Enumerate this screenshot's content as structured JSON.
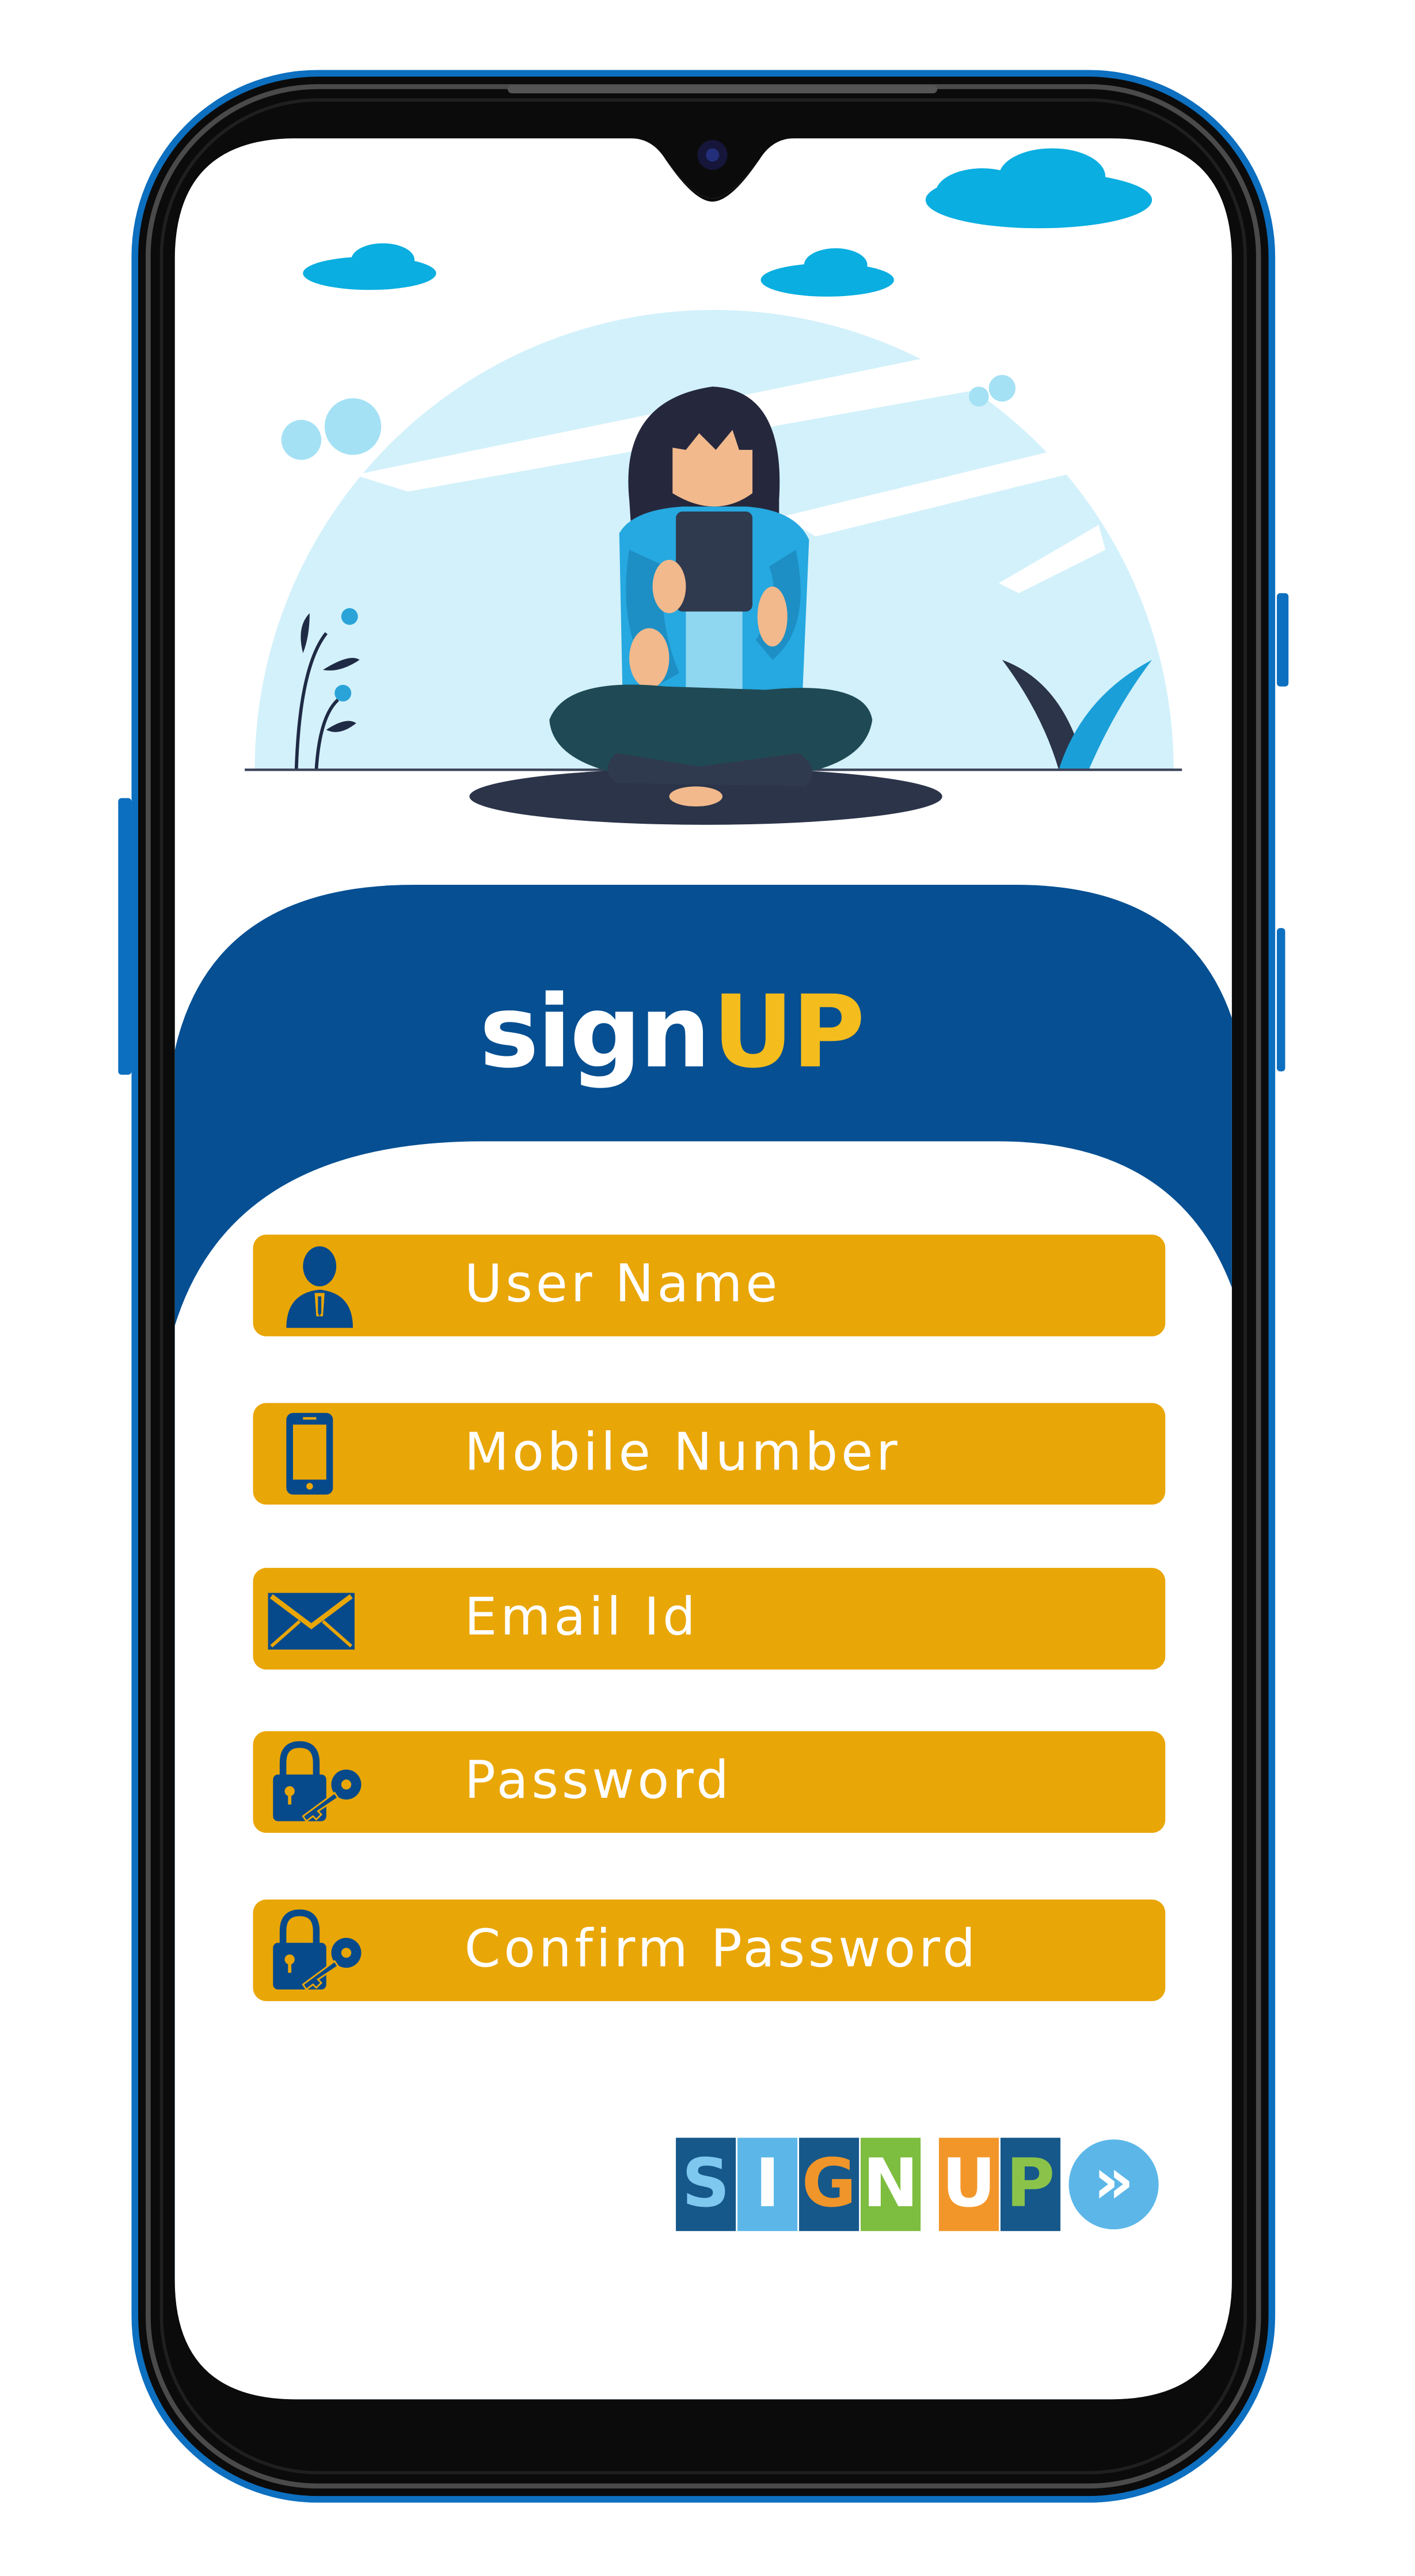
{
  "brand": {
    "sign_part": "sign",
    "up_part": "UP"
  },
  "form": {
    "fields": [
      {
        "label": "User Name",
        "icon": "user-icon"
      },
      {
        "label": "Mobile Number",
        "icon": "mobile-icon"
      },
      {
        "label": "Email Id",
        "icon": "envelope-icon"
      },
      {
        "label": "Password",
        "icon": "lock-key-icon"
      },
      {
        "label": "Confirm Password",
        "icon": "lock-key-icon"
      }
    ]
  },
  "signup_button": {
    "letters": [
      "S",
      "I",
      "G",
      "N",
      "U",
      "P"
    ],
    "arrow": "»"
  },
  "colors": {
    "phone_frame_accent": "#0d6fbf",
    "header_blue": "#054f92",
    "field_bg": "#e9a607",
    "field_text": "#ffffff",
    "brand_accent": "#f4bc1c",
    "icon_blue": "#074a8c"
  }
}
